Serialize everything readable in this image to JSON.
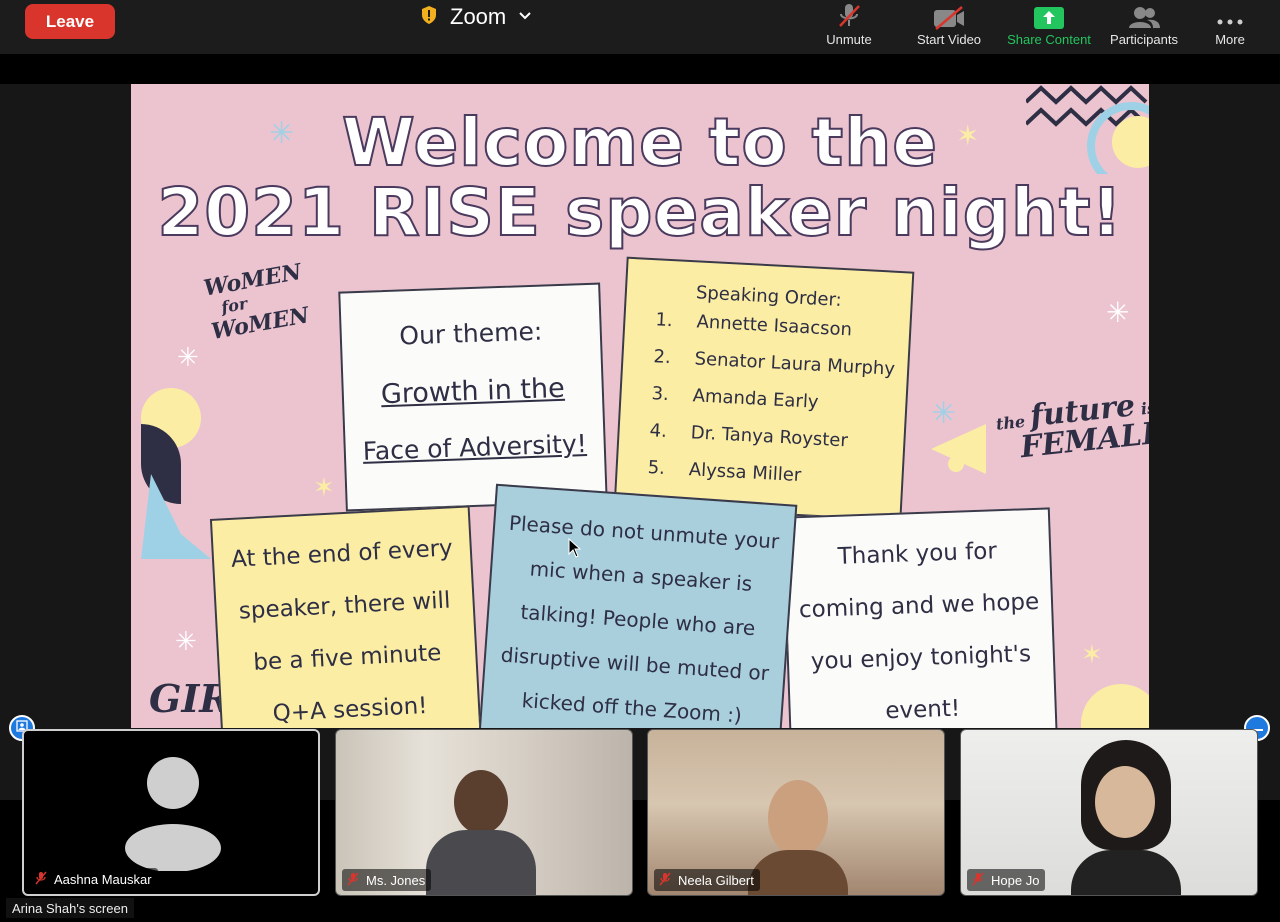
{
  "toolbar": {
    "leave_label": "Leave",
    "title": "Zoom",
    "buttons": [
      {
        "label": "Unmute",
        "icon": "mic-muted-icon"
      },
      {
        "label": "Start Video",
        "icon": "video-off-icon"
      },
      {
        "label": "Share Content",
        "icon": "share-up-arrow-icon"
      },
      {
        "label": "Participants",
        "icon": "participants-icon"
      },
      {
        "label": "More",
        "icon": "more-dots-icon"
      }
    ],
    "share_color": "#22c55e",
    "leave_color": "#d9352c"
  },
  "slide": {
    "title_line1": "Welcome to the",
    "title_line2": "2021 RISE speaker night!",
    "theme_card": {
      "heading": "Our theme:",
      "line1": "Growth in the",
      "line2": "Face of Adversity!"
    },
    "order_card": {
      "heading": "Speaking Order:",
      "items": [
        {
          "num": "1.",
          "name": "Annette Isaacson"
        },
        {
          "num": "2.",
          "name": "Senator Laura Murphy"
        },
        {
          "num": "3.",
          "name": "Amanda Early"
        },
        {
          "num": "4.",
          "name": "Dr. Tanya Royster"
        },
        {
          "num": "5.",
          "name": "Alyssa Miller"
        }
      ]
    },
    "qa_card": "At the end of every speaker, there will be a five minute Q+A session!",
    "mute_card": "Please do not unmute your mic when a speaker is talking! People who are disruptive will be muted or kicked off the Zoom :)",
    "thanks_card": "Thank you for coming and we hope you enjoy tonight's event!",
    "logo_women": [
      "WoMEN",
      "for",
      "WoMEN"
    ],
    "logo_future": {
      "small": "the",
      "big": "future",
      "small2": "is",
      "big2": "FEMALE"
    },
    "logo_girls": "GIRLS"
  },
  "participants": [
    {
      "name": "Aashna Mauskar",
      "muted": true,
      "video": false
    },
    {
      "name": "Ms. Jones",
      "muted": true,
      "video": true
    },
    {
      "name": "Neela Gilbert",
      "muted": true,
      "video": true
    },
    {
      "name": "Hope Jo",
      "muted": true,
      "video": true
    }
  ],
  "screen_label": "Arina Shah's screen"
}
